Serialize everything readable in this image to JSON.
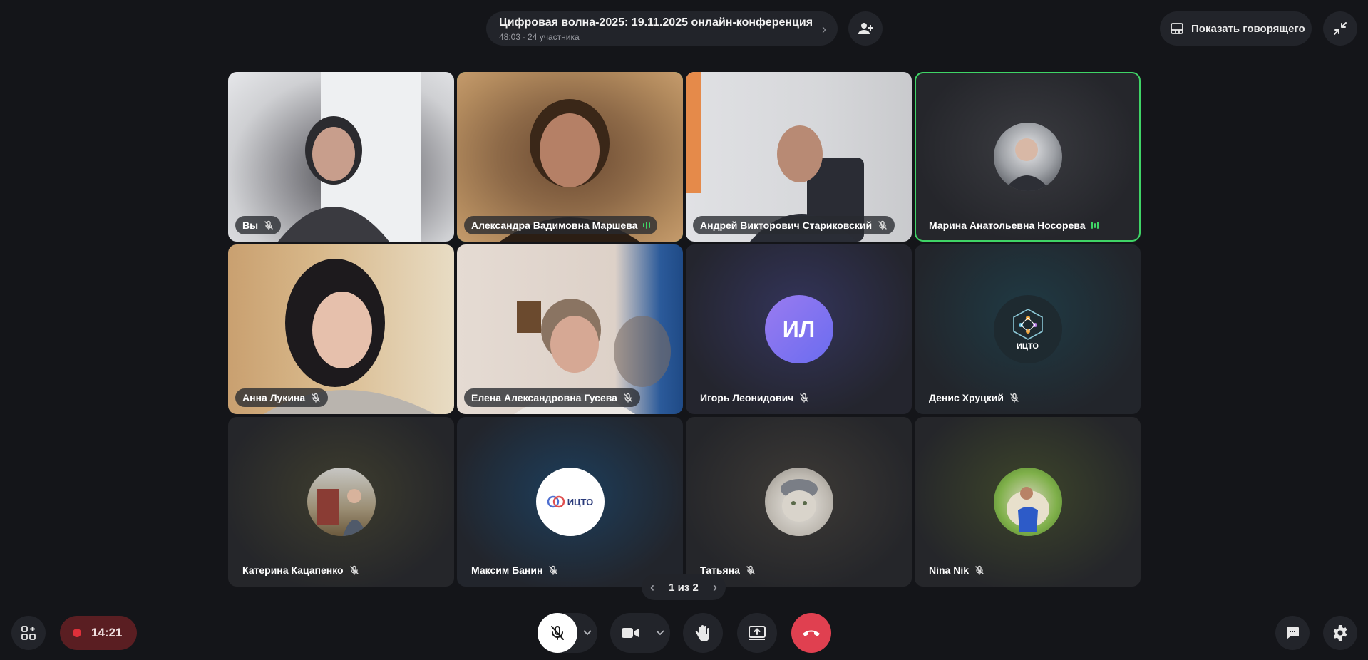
{
  "header": {
    "title": "Цифровая волна-2025: 19.11.2025 онлайн-конференция",
    "elapsed": "48:03",
    "participants": "24 участника",
    "show_speaker_label": "Показать говорящего"
  },
  "tiles": [
    {
      "name": "Вы"
    },
    {
      "name": "Александра Вадимовна Маршева"
    },
    {
      "name": "Андрей Викторович Стариковский"
    },
    {
      "name": "Марина Анатольевна Носорева"
    },
    {
      "name": "Анна Лукина"
    },
    {
      "name": "Елена Александровна Гусева"
    },
    {
      "name": "Игорь Леонидович",
      "initials": "ИЛ"
    },
    {
      "name": "Денис Хруцкий",
      "logo_text": "ИЦТО"
    },
    {
      "name": "Катерина Кацапенко"
    },
    {
      "name": "Максим Банин",
      "logo_text": "ИЦТО"
    },
    {
      "name": "Татьяна"
    },
    {
      "name": "Nina Nik"
    }
  ],
  "pager": {
    "label": "1 из 2"
  },
  "recording": {
    "time": "14:21"
  },
  "colors": {
    "speaking": "#3fd466",
    "end_call": "#e04050",
    "record": "#e0303a"
  }
}
